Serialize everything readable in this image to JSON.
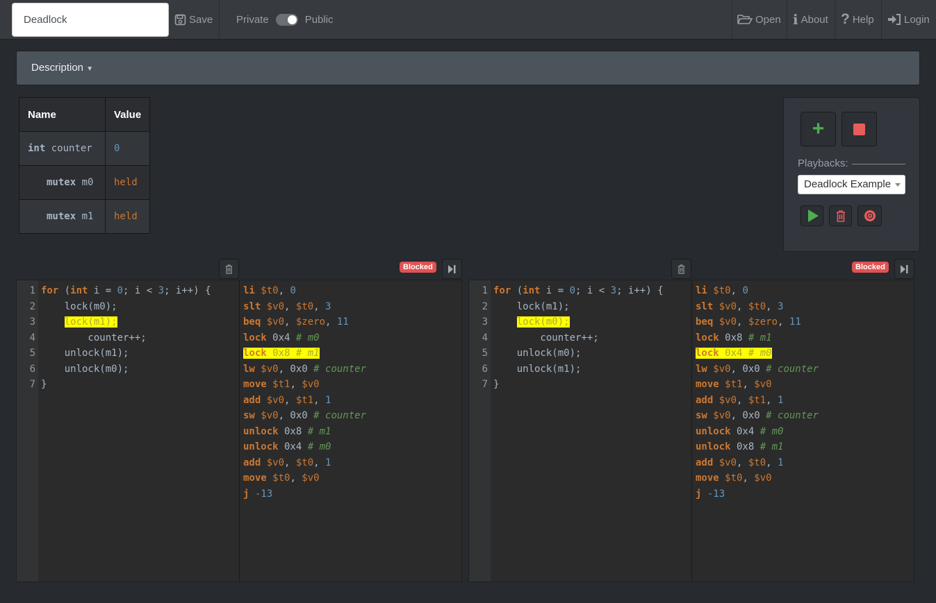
{
  "header": {
    "title_value": "Deadlock",
    "save": "Save",
    "private": "Private",
    "public": "Public",
    "open": "Open",
    "about": "About",
    "help": "Help",
    "login": "Login",
    "visibility_public": true
  },
  "description": {
    "label": "Description"
  },
  "variables": {
    "headers": [
      "Name",
      "Value"
    ],
    "rows": [
      {
        "type": "int",
        "name": "counter",
        "value": "0",
        "value_color": "#6897bb"
      },
      {
        "type": "mutex",
        "name": "m0",
        "value": "held",
        "value_color": "#cc7832"
      },
      {
        "type": "mutex",
        "name": "m1",
        "value": "held",
        "value_color": "#cc7832"
      }
    ]
  },
  "controls": {
    "playbacks_label": "Playbacks:",
    "playback_selected": "Deadlock Example"
  },
  "threads": [
    {
      "status": "Blocked",
      "highlight_src": 2,
      "highlight_asm": 4,
      "source": [
        [
          [
            "kw",
            "for"
          ],
          [
            "txt",
            " ("
          ],
          [
            "kw",
            "int"
          ],
          [
            "txt",
            " i = "
          ],
          [
            "num",
            "0"
          ],
          [
            "txt",
            "; i < "
          ],
          [
            "num",
            "3"
          ],
          [
            "txt",
            "; i++) {"
          ]
        ],
        [
          [
            "txt",
            "    lock(m0);"
          ]
        ],
        [
          [
            "txt",
            "    "
          ],
          [
            "hlt",
            "lock(m1);"
          ]
        ],
        [
          [
            "txt",
            "        counter++;"
          ]
        ],
        [
          [
            "txt",
            "    unlock(m1);"
          ]
        ],
        [
          [
            "txt",
            "    unlock(m0);"
          ]
        ],
        [
          [
            "txt",
            "}"
          ]
        ]
      ],
      "asm": [
        [
          [
            "kw",
            "li"
          ],
          [
            "reg",
            " $t0"
          ],
          [
            "txt",
            ", "
          ],
          [
            "num",
            "0"
          ]
        ],
        [
          [
            "kw",
            "slt"
          ],
          [
            "reg",
            " $v0"
          ],
          [
            "txt",
            ", "
          ],
          [
            "reg",
            "$t0"
          ],
          [
            "txt",
            ", "
          ],
          [
            "num",
            "3"
          ]
        ],
        [
          [
            "kw",
            "beq"
          ],
          [
            "reg",
            " $v0"
          ],
          [
            "txt",
            ", "
          ],
          [
            "reg",
            "$zero"
          ],
          [
            "txt",
            ", "
          ],
          [
            "num",
            "11"
          ]
        ],
        [
          [
            "kw",
            "lock"
          ],
          [
            "txt",
            " 0x4 "
          ],
          [
            "cmt",
            "# m0"
          ]
        ],
        [
          [
            "kw",
            "lock"
          ],
          [
            "txt",
            " 0x8 "
          ],
          [
            "cmt",
            "# m1"
          ]
        ],
        [
          [
            "kw",
            "lw"
          ],
          [
            "reg",
            " $v0"
          ],
          [
            "txt",
            ", 0x0 "
          ],
          [
            "cmt",
            "# counter"
          ]
        ],
        [
          [
            "kw",
            "move"
          ],
          [
            "reg",
            " $t1"
          ],
          [
            "txt",
            ", "
          ],
          [
            "reg",
            "$v0"
          ]
        ],
        [
          [
            "kw",
            "add"
          ],
          [
            "reg",
            " $v0"
          ],
          [
            "txt",
            ", "
          ],
          [
            "reg",
            "$t1"
          ],
          [
            "txt",
            ", "
          ],
          [
            "num",
            "1"
          ]
        ],
        [
          [
            "kw",
            "sw"
          ],
          [
            "reg",
            " $v0"
          ],
          [
            "txt",
            ", 0x0 "
          ],
          [
            "cmt",
            "# counter"
          ]
        ],
        [
          [
            "kw",
            "unlock"
          ],
          [
            "txt",
            " 0x8 "
          ],
          [
            "cmt",
            "# m1"
          ]
        ],
        [
          [
            "kw",
            "unlock"
          ],
          [
            "txt",
            " 0x4 "
          ],
          [
            "cmt",
            "# m0"
          ]
        ],
        [
          [
            "kw",
            "add"
          ],
          [
            "reg",
            " $v0"
          ],
          [
            "txt",
            ", "
          ],
          [
            "reg",
            "$t0"
          ],
          [
            "txt",
            ", "
          ],
          [
            "num",
            "1"
          ]
        ],
        [
          [
            "kw",
            "move"
          ],
          [
            "reg",
            " $t0"
          ],
          [
            "txt",
            ", "
          ],
          [
            "reg",
            "$v0"
          ]
        ],
        [
          [
            "kw",
            "j"
          ],
          [
            "txt",
            " "
          ],
          [
            "num",
            "-13"
          ]
        ]
      ]
    },
    {
      "status": "Blocked",
      "highlight_src": 2,
      "highlight_asm": 4,
      "source": [
        [
          [
            "kw",
            "for"
          ],
          [
            "txt",
            " ("
          ],
          [
            "kw",
            "int"
          ],
          [
            "txt",
            " i = "
          ],
          [
            "num",
            "0"
          ],
          [
            "txt",
            "; i < "
          ],
          [
            "num",
            "3"
          ],
          [
            "txt",
            "; i++) {"
          ]
        ],
        [
          [
            "txt",
            "    lock(m1);"
          ]
        ],
        [
          [
            "txt",
            "    "
          ],
          [
            "hlt",
            "lock(m0);"
          ]
        ],
        [
          [
            "txt",
            "        counter++;"
          ]
        ],
        [
          [
            "txt",
            "    unlock(m0);"
          ]
        ],
        [
          [
            "txt",
            "    unlock(m1);"
          ]
        ],
        [
          [
            "txt",
            "}"
          ]
        ]
      ],
      "asm": [
        [
          [
            "kw",
            "li"
          ],
          [
            "reg",
            " $t0"
          ],
          [
            "txt",
            ", "
          ],
          [
            "num",
            "0"
          ]
        ],
        [
          [
            "kw",
            "slt"
          ],
          [
            "reg",
            " $v0"
          ],
          [
            "txt",
            ", "
          ],
          [
            "reg",
            "$t0"
          ],
          [
            "txt",
            ", "
          ],
          [
            "num",
            "3"
          ]
        ],
        [
          [
            "kw",
            "beq"
          ],
          [
            "reg",
            " $v0"
          ],
          [
            "txt",
            ", "
          ],
          [
            "reg",
            "$zero"
          ],
          [
            "txt",
            ", "
          ],
          [
            "num",
            "11"
          ]
        ],
        [
          [
            "kw",
            "lock"
          ],
          [
            "txt",
            " 0x8 "
          ],
          [
            "cmt",
            "# m1"
          ]
        ],
        [
          [
            "kw",
            "lock"
          ],
          [
            "txt",
            " 0x4 "
          ],
          [
            "cmt",
            "# m0"
          ]
        ],
        [
          [
            "kw",
            "lw"
          ],
          [
            "reg",
            " $v0"
          ],
          [
            "txt",
            ", 0x0 "
          ],
          [
            "cmt",
            "# counter"
          ]
        ],
        [
          [
            "kw",
            "move"
          ],
          [
            "reg",
            " $t1"
          ],
          [
            "txt",
            ", "
          ],
          [
            "reg",
            "$v0"
          ]
        ],
        [
          [
            "kw",
            "add"
          ],
          [
            "reg",
            " $v0"
          ],
          [
            "txt",
            ", "
          ],
          [
            "reg",
            "$t1"
          ],
          [
            "txt",
            ", "
          ],
          [
            "num",
            "1"
          ]
        ],
        [
          [
            "kw",
            "sw"
          ],
          [
            "reg",
            " $v0"
          ],
          [
            "txt",
            ", 0x0 "
          ],
          [
            "cmt",
            "# counter"
          ]
        ],
        [
          [
            "kw",
            "unlock"
          ],
          [
            "txt",
            " 0x4 "
          ],
          [
            "cmt",
            "# m0"
          ]
        ],
        [
          [
            "kw",
            "unlock"
          ],
          [
            "txt",
            " 0x8 "
          ],
          [
            "cmt",
            "# m1"
          ]
        ],
        [
          [
            "kw",
            "add"
          ],
          [
            "reg",
            " $v0"
          ],
          [
            "txt",
            ", "
          ],
          [
            "reg",
            "$t0"
          ],
          [
            "txt",
            ", "
          ],
          [
            "num",
            "1"
          ]
        ],
        [
          [
            "kw",
            "move"
          ],
          [
            "reg",
            " $t0"
          ],
          [
            "txt",
            ", "
          ],
          [
            "reg",
            "$v0"
          ]
        ],
        [
          [
            "kw",
            "j"
          ],
          [
            "txt",
            " "
          ],
          [
            "num",
            "-13"
          ]
        ]
      ]
    }
  ],
  "colors": {
    "highlight": "#ffff00",
    "blocked": "#e05252",
    "add": "#4caf50",
    "stop": "#e85c5c"
  }
}
